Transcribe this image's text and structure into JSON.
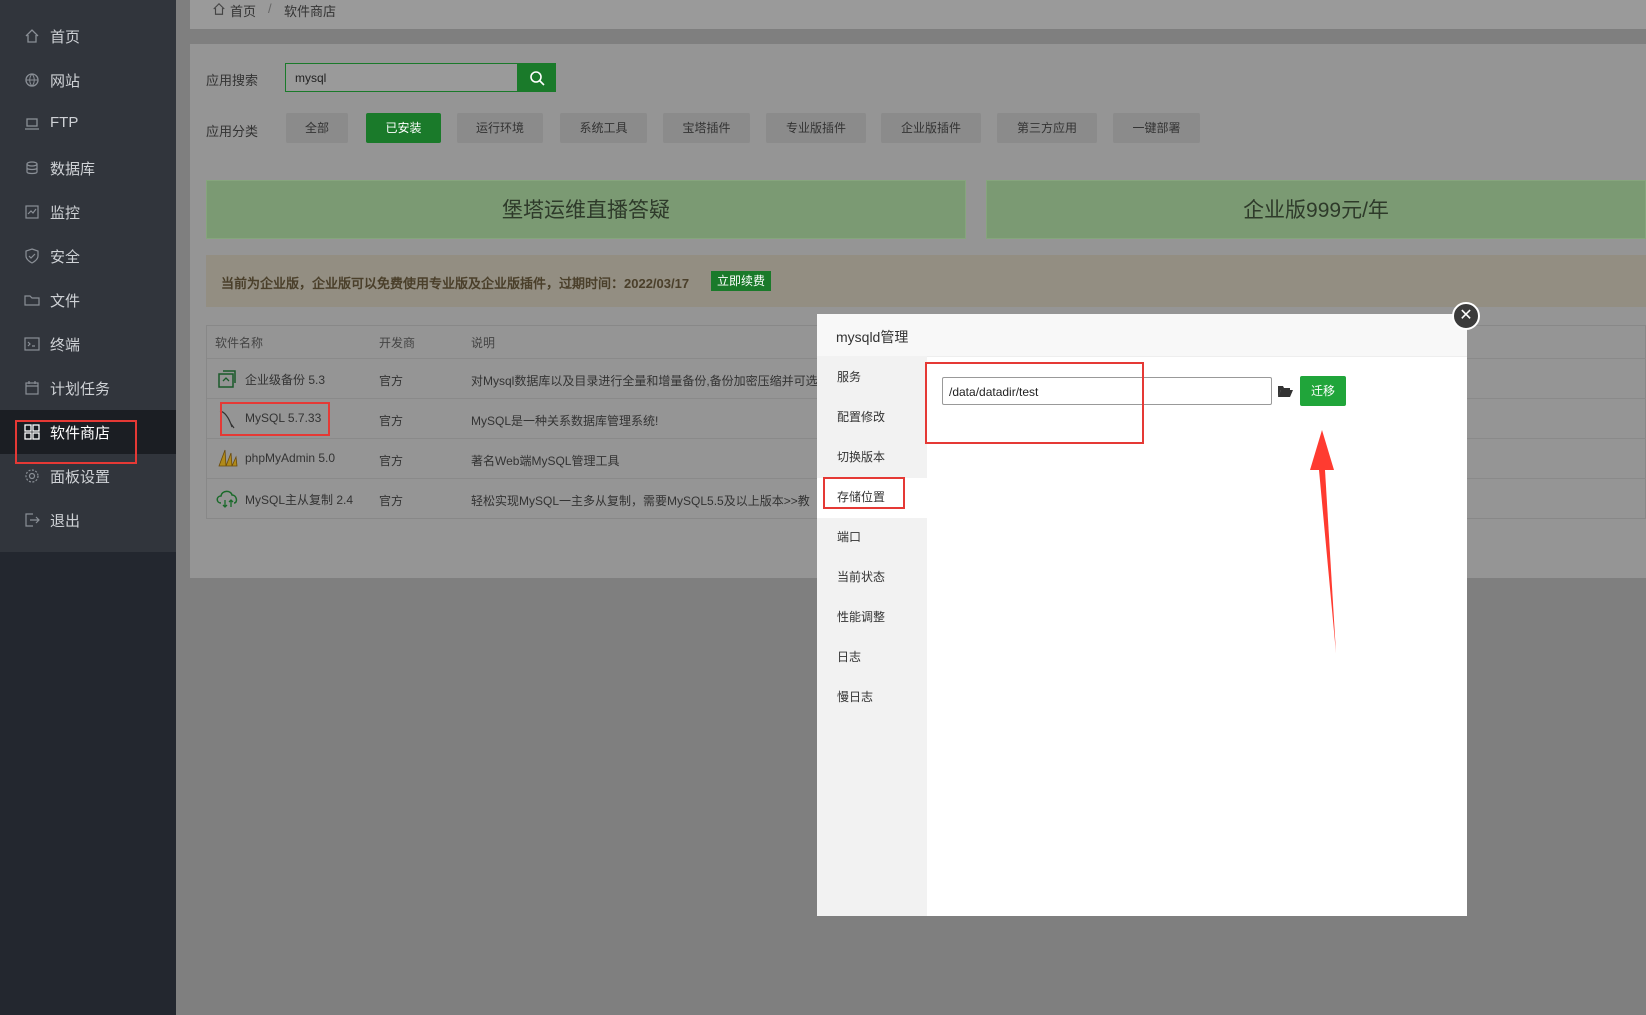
{
  "sidebar": {
    "items": [
      {
        "label": "首页",
        "icon": "home-icon"
      },
      {
        "label": "网站",
        "icon": "globe-icon"
      },
      {
        "label": "FTP",
        "icon": "ftp-icon"
      },
      {
        "label": "数据库",
        "icon": "database-icon"
      },
      {
        "label": "监控",
        "icon": "monitor-icon"
      },
      {
        "label": "安全",
        "icon": "shield-icon"
      },
      {
        "label": "文件",
        "icon": "folder-icon"
      },
      {
        "label": "终端",
        "icon": "terminal-icon"
      },
      {
        "label": "计划任务",
        "icon": "calendar-icon"
      },
      {
        "label": "软件商店",
        "icon": "grid-icon"
      },
      {
        "label": "面板设置",
        "icon": "gear-icon"
      },
      {
        "label": "退出",
        "icon": "logout-icon"
      }
    ],
    "active_index": 9
  },
  "breadcrumb": {
    "home": "首页",
    "sep": "/",
    "current": "软件商店"
  },
  "search": {
    "label": "应用搜索",
    "value": "mysql"
  },
  "categories": {
    "label": "应用分类",
    "items": [
      "全部",
      "已安装",
      "运行环境",
      "系统工具",
      "宝塔插件",
      "专业版插件",
      "企业版插件",
      "第三方应用",
      "一键部署"
    ],
    "active_index": 1
  },
  "banners": [
    "堡塔运维直播答疑",
    "企业版999元/年"
  ],
  "notice": {
    "text": "当前为企业版，企业版可以免费使用专业版及企业版插件，过期时间：2022/03/17",
    "button": "立即续费"
  },
  "table": {
    "headers": [
      "软件名称",
      "开发商",
      "说明"
    ],
    "rows": [
      {
        "name": "企业级备份 5.3",
        "vendor": "官方",
        "desc": "对Mysql数据库以及目录进行全量和增量备份,备份加密压缩并可选"
      },
      {
        "name": "MySQL 5.7.33",
        "vendor": "官方",
        "desc": "MySQL是一种关系数据库管理系统!"
      },
      {
        "name": "phpMyAdmin 5.0",
        "vendor": "官方",
        "desc": "著名Web端MySQL管理工具"
      },
      {
        "name": "MySQL主从复制 2.4",
        "vendor": "官方",
        "desc": "轻松实现MySQL一主多从复制，需要MySQL5.5及以上版本>>教"
      }
    ]
  },
  "modal": {
    "title": "mysqld管理",
    "menu": [
      "服务",
      "配置修改",
      "切换版本",
      "存储位置",
      "端口",
      "当前状态",
      "性能调整",
      "日志",
      "慢日志"
    ],
    "active_index": 3,
    "path_value": "/data/datadir/test",
    "migrate_button": "迁移",
    "close": "✕"
  },
  "colors": {
    "accent": "#20a53a",
    "annotation_red": "#e53935",
    "sidebar_bg": "#31353c"
  }
}
